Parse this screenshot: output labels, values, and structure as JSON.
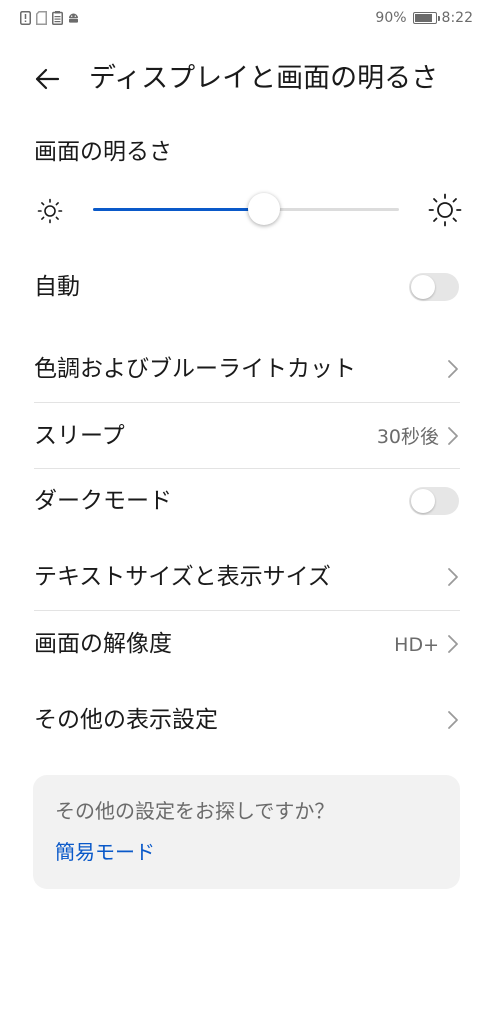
{
  "status_bar": {
    "icons": [
      "alert-icon",
      "sim-icon",
      "clipboard-icon",
      "android-icon"
    ],
    "battery_percent_text": "90%",
    "battery_level": 0.9,
    "time": "8:22"
  },
  "header": {
    "back_icon": "arrow-left-icon",
    "title": "ディスプレイと画面の明るさ"
  },
  "brightness": {
    "title": "画面の明るさ",
    "level": 0.56,
    "accent_color": "#0a59c9"
  },
  "settings": {
    "auto": {
      "label": "自動",
      "enabled": false
    },
    "color_tone": {
      "label": "色調およびブルーライトカット"
    },
    "sleep": {
      "label": "スリープ",
      "value": "30秒後"
    },
    "dark_mode": {
      "label": "ダークモード",
      "enabled": false
    },
    "text_size": {
      "label": "テキストサイズと表示サイズ"
    },
    "resolution": {
      "label": "画面の解像度",
      "value": "HD+"
    },
    "other_display": {
      "label": "その他の表示設定"
    }
  },
  "card": {
    "question": "その他の設定をお探しですか？",
    "link": "簡易モード",
    "link_color": "#0a59c9"
  }
}
